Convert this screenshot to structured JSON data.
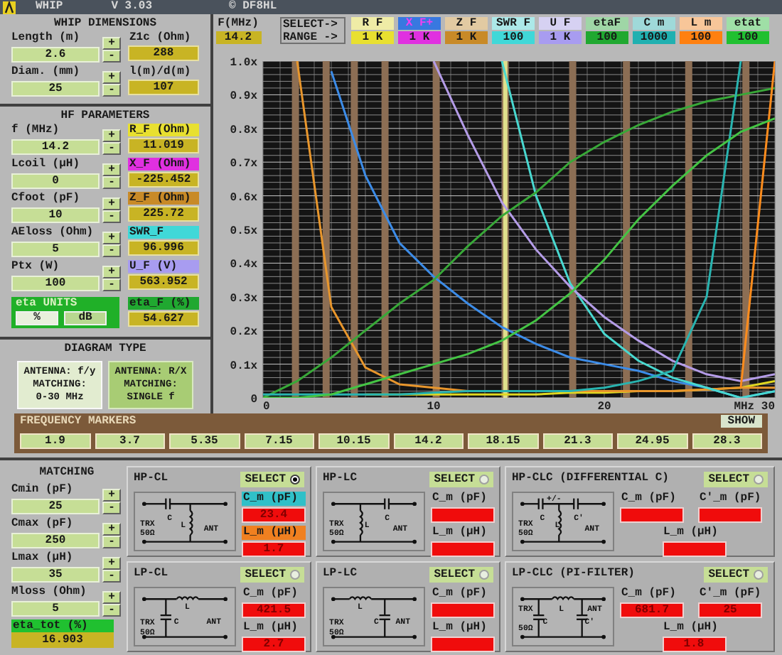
{
  "title_bar": {
    "app": "WHIP",
    "version": "V 3.03",
    "author": "© DF8HL"
  },
  "whip_dimensions": {
    "title": "WHIP DIMENSIONS",
    "rows": [
      {
        "input": {
          "label": "Length (m)",
          "value": "2.6",
          "buttons": [
            "+",
            "-"
          ]
        },
        "result": {
          "label": "Z1c (Ohm)",
          "value": "288"
        }
      },
      {
        "input": {
          "label": "Diam. (mm)",
          "value": "25",
          "buttons": [
            "+",
            "-"
          ]
        },
        "result": {
          "label": "l(m)/d(m)",
          "value": "107"
        }
      }
    ]
  },
  "hf_parameters": {
    "title": "HF PARAMETERS",
    "rows": [
      {
        "input": {
          "label": "f (MHz)",
          "value": "14.2",
          "buttons": [
            "+",
            "-"
          ]
        },
        "result": {
          "label": "R_F (Ohm)",
          "value": "11.019",
          "color": "#e8e030"
        }
      },
      {
        "input": {
          "label": "Lcoil (µH)",
          "value": "0",
          "buttons": [
            "+",
            "-"
          ]
        },
        "result": {
          "label": "X_F (Ohm)",
          "value": "-225.452",
          "color": "#e030e0"
        }
      },
      {
        "input": {
          "label": "Cfoot (pF)",
          "value": "10",
          "buttons": [
            "+",
            "-"
          ]
        },
        "result": {
          "label": "Z_F (Ohm)",
          "value": "225.72",
          "color": "#c88a28"
        }
      },
      {
        "input": {
          "label": "AEloss (Ohm)",
          "value": "5",
          "buttons": [
            "+",
            "-"
          ]
        },
        "result": {
          "label": "SWR_F",
          "value": "96.996",
          "color": "#40d8d8"
        }
      },
      {
        "input": {
          "label": "Ptx (W)",
          "value": "100",
          "buttons": [
            "+",
            "-"
          ]
        },
        "result": {
          "label": "U_F (V)",
          "value": "563.952",
          "color": "#a89cf0"
        }
      }
    ],
    "eta_units": {
      "label": "eta UNITS",
      "options": [
        {
          "label": "%",
          "selected": true
        },
        {
          "label": "dB",
          "selected": false
        }
      ]
    },
    "eta_result": {
      "label": "eta_F (%)",
      "value": "54.627",
      "color": "#20a830"
    }
  },
  "diagram_type": {
    "title": "DIAGRAM TYPE",
    "options": [
      {
        "lines": [
          "ANTENNA: f/y",
          "MATCHING:",
          "0-30 MHz"
        ],
        "selected": true
      },
      {
        "lines": [
          "ANTENNA: R/X",
          "MATCHING:",
          "SINGLE f"
        ],
        "selected": false
      }
    ]
  },
  "chart": {
    "freq_label": "F(MHz)",
    "freq_value": "14.2",
    "select_label": "SELECT->",
    "range_label": "RANGE ->",
    "selectors": [
      {
        "label": "R F",
        "range": "1 K",
        "color": "#e8e030",
        "selected": false
      },
      {
        "label": "X F+",
        "range": "1 K",
        "color": "#e030e0",
        "selected": true
      },
      {
        "label": "Z F",
        "range": "1 K",
        "color": "#c88a28",
        "selected": false
      },
      {
        "label": "SWR F",
        "range": "100",
        "color": "#40d8d8",
        "selected": false
      },
      {
        "label": "U F",
        "range": "1 K",
        "color": "#a89cf0",
        "selected": false
      },
      {
        "label": "etaF",
        "range": "100",
        "color": "#20a830",
        "selected": false
      },
      {
        "label": "C m",
        "range": "1000",
        "color": "#20b0b0",
        "selected": false
      },
      {
        "label": "L m",
        "range": "100",
        "color": "#ff8010",
        "selected": false
      },
      {
        "label": "etat",
        "range": "100",
        "color": "#20c030",
        "selected": false
      }
    ],
    "chart_data": {
      "type": "line",
      "grid": true,
      "ref_lines": [
        {
          "axis": "x",
          "value": 1.9,
          "color": "#8c6e54"
        },
        {
          "axis": "x",
          "value": 3.7,
          "color": "#8c6e54"
        },
        {
          "axis": "x",
          "value": 5.35,
          "color": "#8c6e54"
        },
        {
          "axis": "x",
          "value": 7.15,
          "color": "#8c6e54"
        },
        {
          "axis": "x",
          "value": 10.15,
          "color": "#8c6e54"
        },
        {
          "axis": "x",
          "value": 14.2,
          "color": "#8c6e54"
        },
        {
          "axis": "x",
          "value": 18.15,
          "color": "#8c6e54"
        },
        {
          "axis": "x",
          "value": 21.3,
          "color": "#8c6e54"
        },
        {
          "axis": "x",
          "value": 24.95,
          "color": "#8c6e54"
        },
        {
          "axis": "x",
          "value": 28.3,
          "color": "#8c6e54"
        },
        {
          "axis": "x",
          "value": 14.2,
          "color": "#e0e08c"
        }
      ],
      "x": [
        0,
        2,
        4,
        6,
        8,
        10,
        12,
        14,
        16,
        18,
        20,
        22,
        24,
        26,
        28,
        30
      ],
      "xlim": [
        0,
        30
      ],
      "ylim": [
        0,
        1
      ],
      "xticks": [
        0,
        10,
        20,
        {
          "value": 30,
          "label": "MHz 30"
        }
      ],
      "yticks": [
        {
          "value": 0,
          "label": "0"
        },
        {
          "value": 0.1,
          "label": "0.1x"
        },
        {
          "value": 0.2,
          "label": "0.2x"
        },
        {
          "value": 0.3,
          "label": "0.3x"
        },
        {
          "value": 0.4,
          "label": "0.4x"
        },
        {
          "value": 0.5,
          "label": "0.5x"
        },
        {
          "value": 0.6,
          "label": "0.6x"
        },
        {
          "value": 0.7,
          "label": "0.7x"
        },
        {
          "value": 0.8,
          "label": "0.8x"
        },
        {
          "value": 0.9,
          "label": "0.9x"
        },
        {
          "value": 1,
          "label": "1.0x"
        }
      ],
      "series": [
        {
          "color": "#e0d820",
          "values": [
            null,
            null,
            null,
            0.01,
            0.01,
            0.01,
            0.01,
            0.01,
            0.01,
            0.015,
            0.015,
            0.02,
            0.02,
            0.025,
            0.03,
            0.05
          ]
        },
        {
          "color": "#3c8ce8",
          "values": [
            null,
            null,
            0.97,
            0.66,
            0.46,
            0.36,
            0.28,
            0.21,
            0.16,
            0.12,
            0.1,
            0.08,
            0.05,
            0.03,
            0.0,
            0.02
          ]
        },
        {
          "color": "#e8962c",
          "values": [
            null,
            1.0,
            0.27,
            0.09,
            0.04,
            0.03,
            0.02,
            0.02,
            0.02,
            0.02,
            0.02,
            0.02,
            0.02,
            0.025,
            0.03,
            0.03
          ]
        },
        {
          "color": "#48d8d0",
          "values": [
            null,
            null,
            null,
            null,
            null,
            null,
            null,
            1.0,
            0.6,
            0.34,
            0.19,
            0.11,
            0.06,
            0.03,
            0.0,
            0.02
          ]
        },
        {
          "color": "#b49ce8",
          "values": [
            null,
            null,
            null,
            null,
            null,
            1.0,
            0.78,
            0.58,
            0.44,
            0.33,
            0.24,
            0.17,
            0.11,
            0.07,
            0.05,
            0.07
          ]
        },
        {
          "color": "#38a838",
          "values": [
            0,
            0.05,
            0.12,
            0.2,
            0.28,
            0.35,
            0.45,
            0.54,
            0.61,
            0.7,
            0.76,
            0.81,
            0.85,
            0.88,
            0.9,
            0.92
          ]
        },
        {
          "color": "#28b4b0",
          "values": [
            0.01,
            0.01,
            0.01,
            0.01,
            0.01,
            0.015,
            0.02,
            0.02,
            0.02,
            0.02,
            0.03,
            0.05,
            0.08,
            0.3,
            1.0,
            null
          ]
        },
        {
          "color": "#ff8c1c",
          "values": [
            null,
            null,
            null,
            null,
            null,
            null,
            null,
            null,
            null,
            null,
            null,
            null,
            null,
            null,
            0.03,
            1.0
          ]
        },
        {
          "color": "#44c444",
          "values": [
            0,
            0,
            0.01,
            0.04,
            0.07,
            0.1,
            0.13,
            0.17,
            0.23,
            0.31,
            0.41,
            0.53,
            0.63,
            0.72,
            0.79,
            0.83
          ]
        }
      ]
    }
  },
  "frequency_markers": {
    "title": "FREQUENCY MARKERS",
    "show_button": "SHOW",
    "values": [
      "1.9",
      "3.7",
      "5.35",
      "7.15",
      "10.15",
      "14.2",
      "18.15",
      "21.3",
      "24.95",
      "28.3"
    ]
  },
  "matching": {
    "title": "MATCHING",
    "inputs": [
      {
        "label": "Cmin (pF)",
        "value": "25",
        "buttons": [
          "+",
          "-"
        ]
      },
      {
        "label": "Cmax (pF)",
        "value": "250",
        "buttons": [
          "+",
          "-"
        ]
      },
      {
        "label": "Lmax (µH)",
        "value": "35",
        "buttons": [
          "+",
          "-"
        ]
      },
      {
        "label": "Mloss (Ohm)",
        "value": "5",
        "buttons": [
          "+",
          "-"
        ]
      }
    ],
    "result": {
      "label": "eta_tot (%)",
      "value": "16.903"
    }
  },
  "networks": [
    {
      "title": "HP-CL",
      "select": "SELECT",
      "selected": true,
      "schematic": {
        "kind": "hp-cl",
        "labels": [
          "TRX",
          "50Ω",
          "C",
          "L",
          "ANT"
        ]
      },
      "outputs": [
        {
          "label": "C_m (pF)",
          "value": "23.4",
          "color": "#30c0c8"
        },
        {
          "label": "L_m (µH)",
          "value": "1.7",
          "color": "#f08020"
        }
      ]
    },
    {
      "title": "HP-LC",
      "select": "SELECT",
      "selected": false,
      "schematic": {
        "kind": "hp-lc",
        "labels": [
          "TRX",
          "50Ω",
          "L",
          "C",
          "ANT"
        ]
      },
      "outputs": [
        {
          "label": "C_m (pF)"
        },
        {
          "label": "L_m (µH)"
        }
      ]
    },
    {
      "title": "HP-CLC (DIFFERENTIAL C)",
      "select": "SELECT",
      "selected": false,
      "schematic": {
        "kind": "hp-clc",
        "labels": [
          "TRX",
          "50Ω",
          "C",
          "+/-",
          "L",
          "C'",
          "ANT"
        ]
      },
      "outputs": [
        {
          "label": "C_m (pF)"
        },
        {
          "label": "C'_m (pF)"
        },
        {
          "label": "L_m (µH)"
        }
      ]
    },
    {
      "title": "LP-CL",
      "select": "SELECT",
      "selected": false,
      "schematic": {
        "kind": "lp-cl",
        "labels": [
          "TRX",
          "50Ω",
          "L",
          "C",
          "ANT"
        ]
      },
      "outputs": [
        {
          "label": "C_m (pF)",
          "value": "421.5"
        },
        {
          "label": "L_m (µH)",
          "value": "2.7"
        }
      ]
    },
    {
      "title": "LP-LC",
      "select": "SELECT",
      "selected": false,
      "schematic": {
        "kind": "lp-lc",
        "labels": [
          "TRX",
          "50Ω",
          "L",
          "C",
          "ANT"
        ]
      },
      "outputs": [
        {
          "label": "C_m (pF)"
        },
        {
          "label": "L_m (µH)"
        }
      ]
    },
    {
      "title": "LP-CLC (PI-FILTER)",
      "select": "SELECT",
      "selected": false,
      "schematic": {
        "kind": "lp-clc",
        "labels": [
          "TRX",
          "L",
          "ANT",
          "C",
          "C'",
          "50Ω"
        ]
      },
      "outputs": [
        {
          "label": "C_m (pF)",
          "value": "681.7"
        },
        {
          "label": "C'_m (pF)",
          "value": "25"
        },
        {
          "label": "L_m (µH)",
          "value": "1.8"
        }
      ]
    }
  ]
}
